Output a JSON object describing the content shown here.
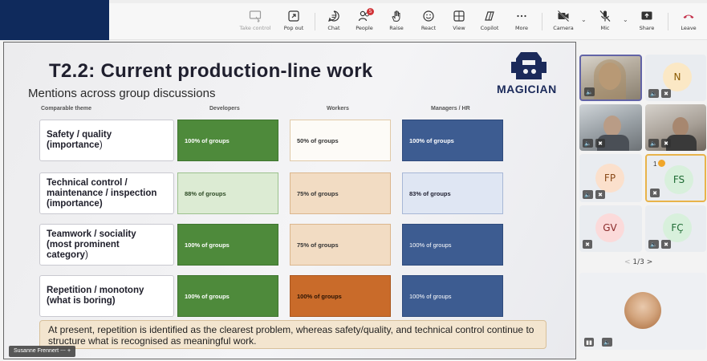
{
  "toolbar": {
    "buttons": [
      {
        "label": "Take control",
        "icon": "take-control-icon"
      },
      {
        "label": "Pop out",
        "icon": "pop-out-icon"
      },
      {
        "label": "Chat",
        "icon": "chat-icon"
      },
      {
        "label": "People",
        "icon": "people-icon",
        "badge": "5"
      },
      {
        "label": "Raise",
        "icon": "raise-hand-icon"
      },
      {
        "label": "React",
        "icon": "react-icon"
      },
      {
        "label": "View",
        "icon": "view-icon"
      },
      {
        "label": "Copilot",
        "icon": "copilot-icon"
      },
      {
        "label": "More",
        "icon": "more-icon"
      },
      {
        "label": "Camera",
        "icon": "camera-off-icon"
      },
      {
        "label": "Mic",
        "icon": "mic-off-icon"
      },
      {
        "label": "Share",
        "icon": "share-icon"
      },
      {
        "label": "Leave",
        "icon": "leave-icon"
      }
    ],
    "accent_color": "#0f2a5c",
    "leave_color": "#c4314b"
  },
  "slide": {
    "title": "T2.2: Current production-line work",
    "subtitle": "Mentions across group discussions",
    "logo_text": "MAGICIAN",
    "columns": [
      "Comparable theme",
      "Developers",
      "Workers",
      "Managers / HR"
    ],
    "rows": [
      {
        "theme_bold": "Safety / quality",
        "theme_bold2": "(importance",
        "theme_rest": ")",
        "dev": "100% of groups",
        "wor": "50% of groups",
        "man": "100% of groups"
      },
      {
        "theme_bold": "Technical control /",
        "theme_bold2": "maintenance / inspection",
        "theme_bold3": "(importance)",
        "dev": "88% of groups",
        "wor": "75% of groups",
        "man": "83% of groups"
      },
      {
        "theme_bold": "Teamwork / sociality",
        "theme_bold2": "(most prominent",
        "theme_bold3": "category",
        "theme_rest": ")",
        "dev": "100% of groups",
        "wor": "75% of groups",
        "man": "100% of groups"
      },
      {
        "theme_bold": "Repetition / monotony",
        "theme_bold2": "(what is boring)",
        "dev": "100% of groups",
        "wor": "100% of groups",
        "man": "100% of groups"
      }
    ],
    "note": "At present, repetition is identified as the clearest problem, whereas safety/quality, and technical control continue to structure what is recognised as meaningful work.",
    "presenter": "Susanne Frennert"
  },
  "participants": [
    {
      "initials": "N"
    },
    {
      "initials": "FP"
    },
    {
      "initials": "FS",
      "raised": "1"
    },
    {
      "initials": "GV"
    },
    {
      "initials": "FÇ"
    }
  ],
  "pager": {
    "prev": "<",
    "text": "1/3",
    "next": ">"
  }
}
